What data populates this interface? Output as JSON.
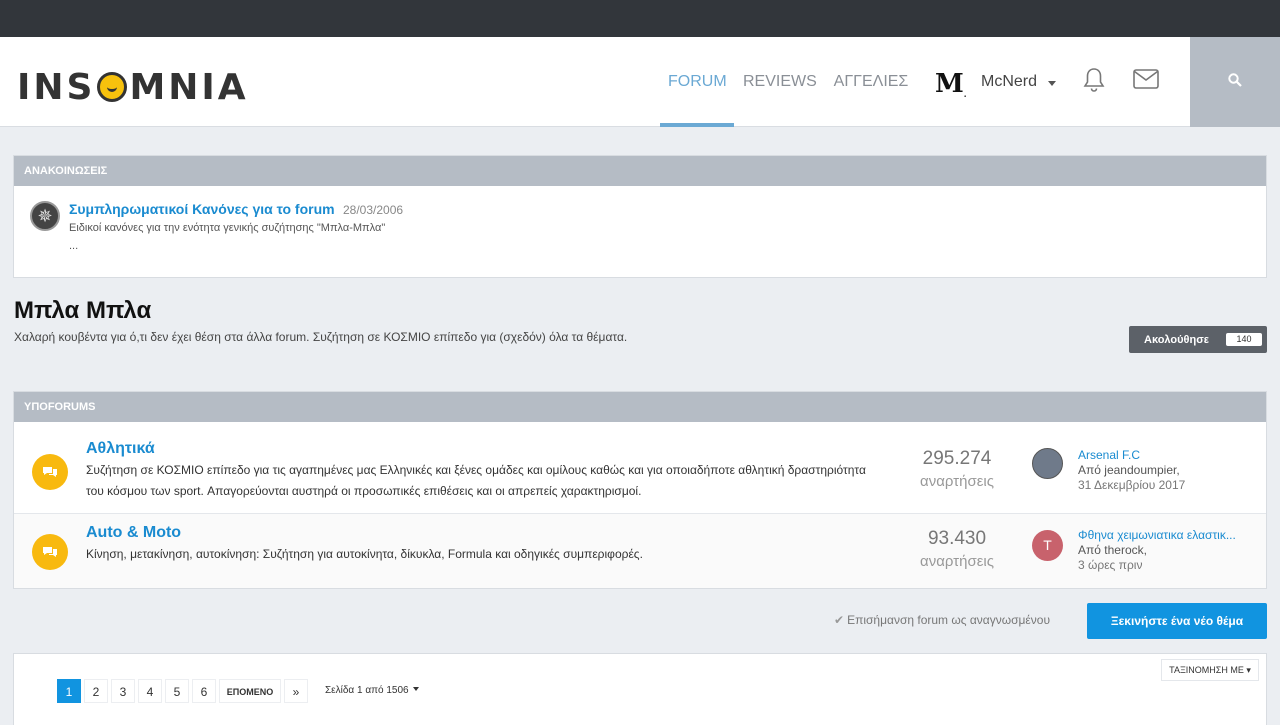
{
  "header": {
    "logo_text_left": "INS",
    "logo_text_right": "MNIA",
    "nav": [
      {
        "label": "FORUM"
      },
      {
        "label": "REVIEWS"
      },
      {
        "label": "ΑΓΓΕΛΙΕΣ"
      }
    ],
    "brand_glyph": "M",
    "brand_mark": ".",
    "user_name": "McNerd",
    "icons": [
      "bell-icon",
      "mail-icon",
      "search-icon"
    ]
  },
  "announcements": {
    "heading": "ΑΝΑΚΟΙΝΩΣΕΙΣ",
    "item": {
      "title": "Συμπληρωματικοί Κανόνες για το forum",
      "date": "28/03/2006",
      "desc": "Ειδικοί κανόνες για την ενότητα γενικής συζήτησης \"Μπλα-Μπλα\"",
      "more": "..."
    }
  },
  "forum": {
    "title": "Μπλα Μπλα",
    "desc": "Χαλαρή κουβέντα για ό,τι δεν έχει θέση στα άλλα forum. Συζήτηση σε ΚΟΣΜΙΟ επίπεδο για (σχεδόν) όλα τα θέματα.",
    "follow_label": "Ακολούθησε",
    "follow_count": "140"
  },
  "subforums": {
    "heading": "ΥΠΟFORUMS",
    "items": [
      {
        "name": "Αθλητικά",
        "desc": "Συζήτηση σε ΚΟΣΜΙΟ επίπεδο για τις αγαπημένες μας Ελληνικές και ξένες ομάδες και ομίλους καθώς και για οποιαδήποτε αθλητική δραστηριότητα του κόσμου των sport. Απαγορεύονται αυστηρά οι προσωπικές επιθέσεις και οι απρεπείς χαρακτηρισμοί.",
        "count": "295.274",
        "count_label": "αναρτήσεις",
        "last_title": "Arsenal F.C",
        "last_by": "Από jeandoumpier,",
        "last_time": "31 Δεκεμβρίου 2017"
      },
      {
        "name": "Auto & Moto",
        "desc": "Κίνηση, μετακίνηση, αυτοκίνηση: Συζήτηση για αυτοκίνητα, δίκυκλα, Formula και οδηγικές συμπεριφορές.",
        "count": "93.430",
        "count_label": "αναρτήσεις",
        "avatar_letter": "T",
        "last_title": "Φθηνα χειμωνιατικα ελαστικ...",
        "last_by": "Από therock,",
        "last_time": "3 ώρες πριν"
      }
    ]
  },
  "actions": {
    "mark_read": "Επισήμανση forum ως αναγνωσμένου",
    "new_topic": "Ξεκινήστε ένα νέο θέμα"
  },
  "pagination": {
    "sort_label": "ΤΑΞΙΝΟΜΗΣΗ ΜΕ",
    "pages": [
      "1",
      "2",
      "3",
      "4",
      "5",
      "6"
    ],
    "next_label": "ΕΠΟΜΕΝΟ",
    "last_label": "»",
    "page_info": "Σελίδα 1 από 1506"
  },
  "colors": {
    "accent": "#1194e0",
    "nav_active": "#6ba9d4",
    "subforum_icon": "#f8b90f"
  }
}
